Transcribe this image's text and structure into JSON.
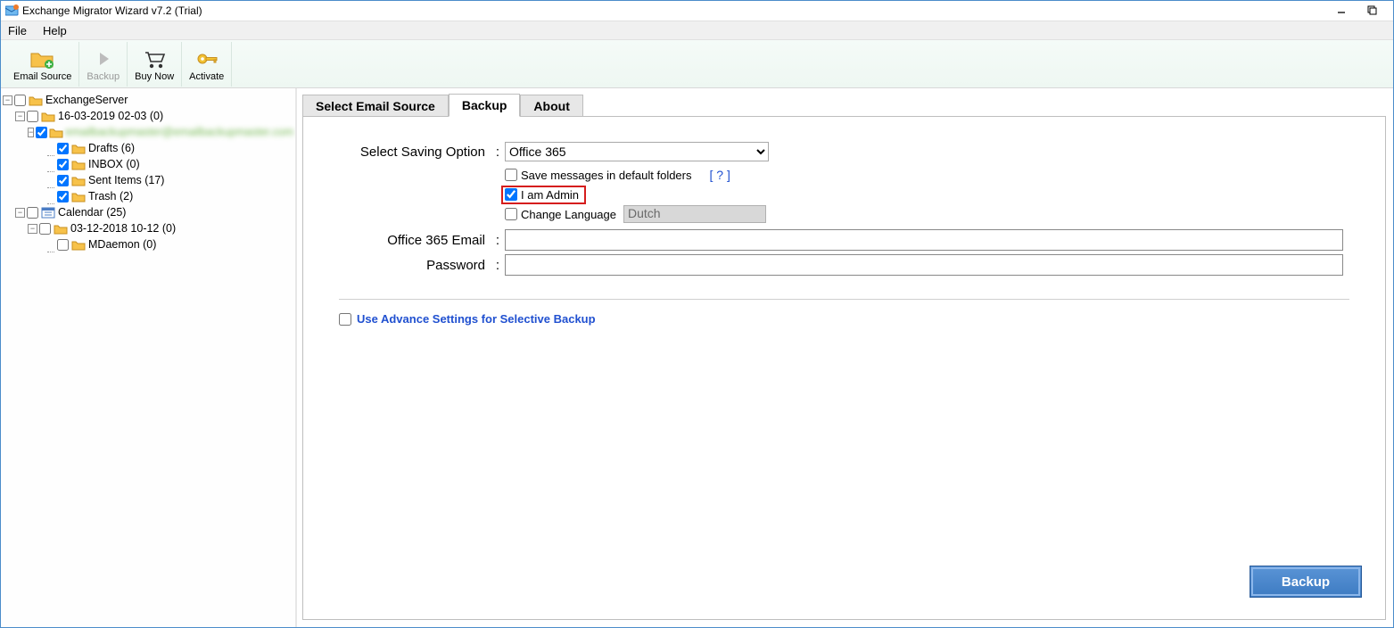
{
  "window": {
    "title": "Exchange Migrator Wizard v7.2 (Trial)"
  },
  "menubar": {
    "file": "File",
    "help": "Help"
  },
  "toolbar": {
    "email_source": "Email Source",
    "backup": "Backup",
    "buy_now": "Buy Now",
    "activate": "Activate"
  },
  "tree": {
    "root": "ExchangeServer",
    "n1": "16-03-2019 02-03 (0)",
    "n1a_blur": "emailbackupmaster@emailbackupmaster.com",
    "drafts": "Drafts (6)",
    "inbox": "INBOX (0)",
    "sent": "Sent Items (17)",
    "trash": "Trash (2)",
    "calendar": "Calendar (25)",
    "n2": "03-12-2018 10-12 (0)",
    "mdaemon": "MDaemon (0)"
  },
  "tabs": {
    "select_source": "Select Email Source",
    "backup": "Backup",
    "about": "About"
  },
  "form": {
    "saving_label": "Select Saving Option",
    "saving_value": "Office 365",
    "save_default": "Save messages in default folders",
    "help": "[ ? ]",
    "i_am_admin": "I am Admin",
    "change_lang": "Change Language",
    "lang_value": "Dutch",
    "email_label": "Office 365 Email",
    "password_label": "Password",
    "advance": "Use Advance Settings for Selective Backup",
    "backup_btn": "Backup"
  }
}
